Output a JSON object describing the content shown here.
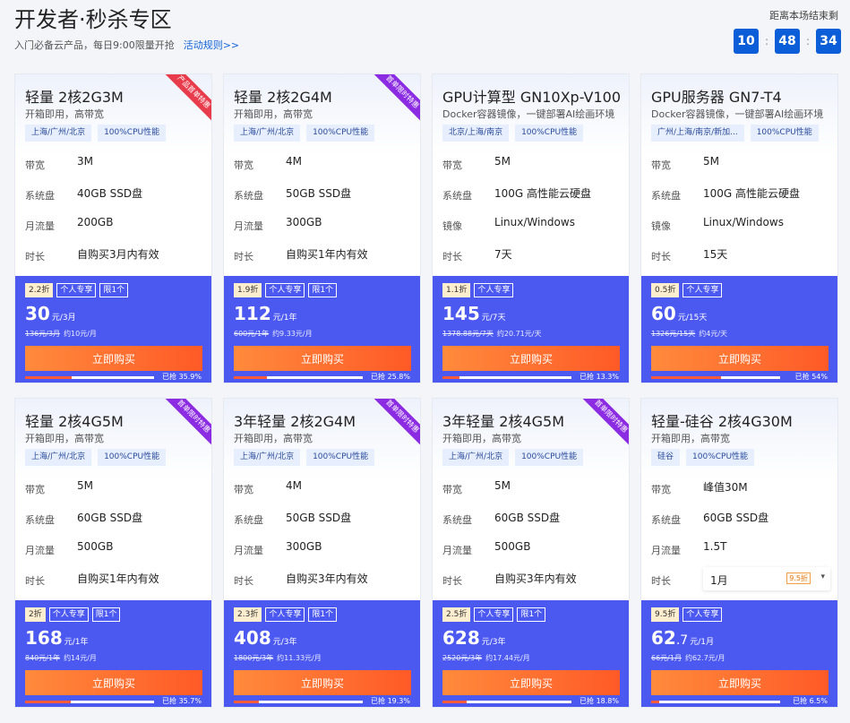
{
  "header": {
    "title": "开发者·秒杀专区",
    "subtitle": "入门必备云产品，每日9:00限量开抢",
    "rules_link": "活动规则>>",
    "countdown_label": "距离本场结束剩",
    "countdown": [
      "10",
      "48",
      "34"
    ]
  },
  "spec_labels": {
    "bandwidth": "带宽",
    "disk": "系统盘",
    "traffic": "月流量",
    "image": "镜像",
    "duration": "时长"
  },
  "buy_label": "立即购买",
  "colors": {
    "blue_panel": "#4c59f1",
    "buy_button": "#ff5a27",
    "countdown_box": "#0b5ed7"
  },
  "cards": [
    {
      "name": "轻量 2核2G3M",
      "desc": "开箱即用，高带宽",
      "tags": [
        "上海/广州/北京",
        "100%CPU性能"
      ],
      "ribbon": "产品首单特惠",
      "ribbon_color": "red",
      "specs": [
        [
          "带宽",
          "3M"
        ],
        [
          "系统盘",
          "40GB SSD盘"
        ],
        [
          "月流量",
          "200GB"
        ],
        [
          "时长",
          "自购买3月内有效"
        ]
      ],
      "badges": [
        "2.2折",
        "个人专享",
        "限1个"
      ],
      "price": "30",
      "price_unit": "元/3月",
      "orig": "136元/3月",
      "per_month": "约10元/月",
      "sold": "已抢 35.9%",
      "progress": 0.359
    },
    {
      "name": "轻量 2核2G4M",
      "desc": "开箱即用，高带宽",
      "tags": [
        "上海/广州/北京",
        "100%CPU性能"
      ],
      "ribbon": "首单限时特惠",
      "ribbon_color": "purple",
      "specs": [
        [
          "带宽",
          "4M"
        ],
        [
          "系统盘",
          "50GB SSD盘"
        ],
        [
          "月流量",
          "300GB"
        ],
        [
          "时长",
          "自购买1年内有效"
        ]
      ],
      "badges": [
        "1.9折",
        "个人专享",
        "限1个"
      ],
      "price": "112",
      "price_unit": "元/1年",
      "orig": "600元/1年",
      "per_month": "约9.33元/月",
      "sold": "已抢 25.8%",
      "progress": 0.258
    },
    {
      "name": "GPU计算型 GN10Xp-V100",
      "desc": "Docker容器镜像，一键部署AI绘画环境",
      "tags": [
        "北京/上海/南京",
        "100%CPU性能"
      ],
      "ribbon": "",
      "ribbon_color": "",
      "specs": [
        [
          "带宽",
          "5M"
        ],
        [
          "系统盘",
          "100G 高性能云硬盘"
        ],
        [
          "镜像",
          "Linux/Windows"
        ],
        [
          "时长",
          "7天"
        ]
      ],
      "badges": [
        "1.1折",
        "个人专享"
      ],
      "price": "145",
      "price_unit": "元/7天",
      "orig": "1378.88元/7天",
      "per_month": "约20.71元/天",
      "sold": "已抢 13.3%",
      "progress": 0.133
    },
    {
      "name": "GPU服务器 GN7-T4",
      "desc": "Docker容器镜像，一键部署AI绘画环境",
      "tags": [
        "广州/上海/南京/新加...",
        "100%CPU性能"
      ],
      "ribbon": "",
      "ribbon_color": "",
      "specs": [
        [
          "带宽",
          "5M"
        ],
        [
          "系统盘",
          "100G 高性能云硬盘"
        ],
        [
          "镜像",
          "Linux/Windows"
        ],
        [
          "时长",
          "15天"
        ]
      ],
      "badges": [
        "0.5折",
        "个人专享"
      ],
      "price": "60",
      "price_unit": "元/15天",
      "orig": "1326元/15天",
      "per_month": "约4元/天",
      "sold": "已抢 54%",
      "progress": 0.54
    },
    {
      "name": "轻量 2核4G5M",
      "desc": "开箱即用，高带宽",
      "tags": [
        "上海/广州/北京",
        "100%CPU性能"
      ],
      "ribbon": "首单限时特惠",
      "ribbon_color": "purple",
      "specs": [
        [
          "带宽",
          "5M"
        ],
        [
          "系统盘",
          "60GB SSD盘"
        ],
        [
          "月流量",
          "500GB"
        ],
        [
          "时长",
          "自购买1年内有效"
        ]
      ],
      "badges": [
        "2折",
        "个人专享",
        "限1个"
      ],
      "price": "168",
      "price_unit": "元/1年",
      "orig": "840元/1年",
      "per_month": "约14元/月",
      "sold": "已抢 35.7%",
      "progress": 0.357
    },
    {
      "name": "3年轻量 2核2G4M",
      "desc": "开箱即用，高带宽",
      "tags": [
        "上海/广州/北京",
        "100%CPU性能"
      ],
      "ribbon": "首单限时特惠",
      "ribbon_color": "purple",
      "specs": [
        [
          "带宽",
          "4M"
        ],
        [
          "系统盘",
          "50GB SSD盘"
        ],
        [
          "月流量",
          "300GB"
        ],
        [
          "时长",
          "自购买3年内有效"
        ]
      ],
      "badges": [
        "2.3折",
        "个人专享",
        "限1个"
      ],
      "price": "408",
      "price_unit": "元/3年",
      "orig": "1800元/3年",
      "per_month": "约11.33元/月",
      "sold": "已抢 19.3%",
      "progress": 0.193
    },
    {
      "name": "3年轻量 2核4G5M",
      "desc": "开箱即用，高带宽",
      "tags": [
        "上海/广州/北京",
        "100%CPU性能"
      ],
      "ribbon": "首单限时特惠",
      "ribbon_color": "purple",
      "specs": [
        [
          "带宽",
          "5M"
        ],
        [
          "系统盘",
          "60GB SSD盘"
        ],
        [
          "月流量",
          "500GB"
        ],
        [
          "时长",
          "自购买3年内有效"
        ]
      ],
      "badges": [
        "2.5折",
        "个人专享",
        "限1个"
      ],
      "price": "628",
      "price_unit": "元/3年",
      "orig": "2520元/3年",
      "per_month": "约17.44元/月",
      "sold": "已抢 18.8%",
      "progress": 0.188
    },
    {
      "name": "轻量-硅谷 2核4G30M",
      "desc": "开箱即用，高带宽",
      "tags": [
        "硅谷",
        "100%CPU性能"
      ],
      "ribbon": "",
      "ribbon_color": "",
      "specs": [
        [
          "带宽",
          "峰值30M"
        ],
        [
          "系统盘",
          "60GB SSD盘"
        ],
        [
          "月流量",
          "1.5T"
        ],
        [
          "时长",
          ""
        ]
      ],
      "duration_select": {
        "value": "1月",
        "badge": "9.5折"
      },
      "badges": [
        "9.5折",
        "个人专享"
      ],
      "price": "62",
      "price_decimal": ".7",
      "price_unit": "元/1月",
      "orig": "66元/1月",
      "per_month": "约62.7元/月",
      "sold": "已抢 6.5%",
      "progress": 0.065
    }
  ]
}
